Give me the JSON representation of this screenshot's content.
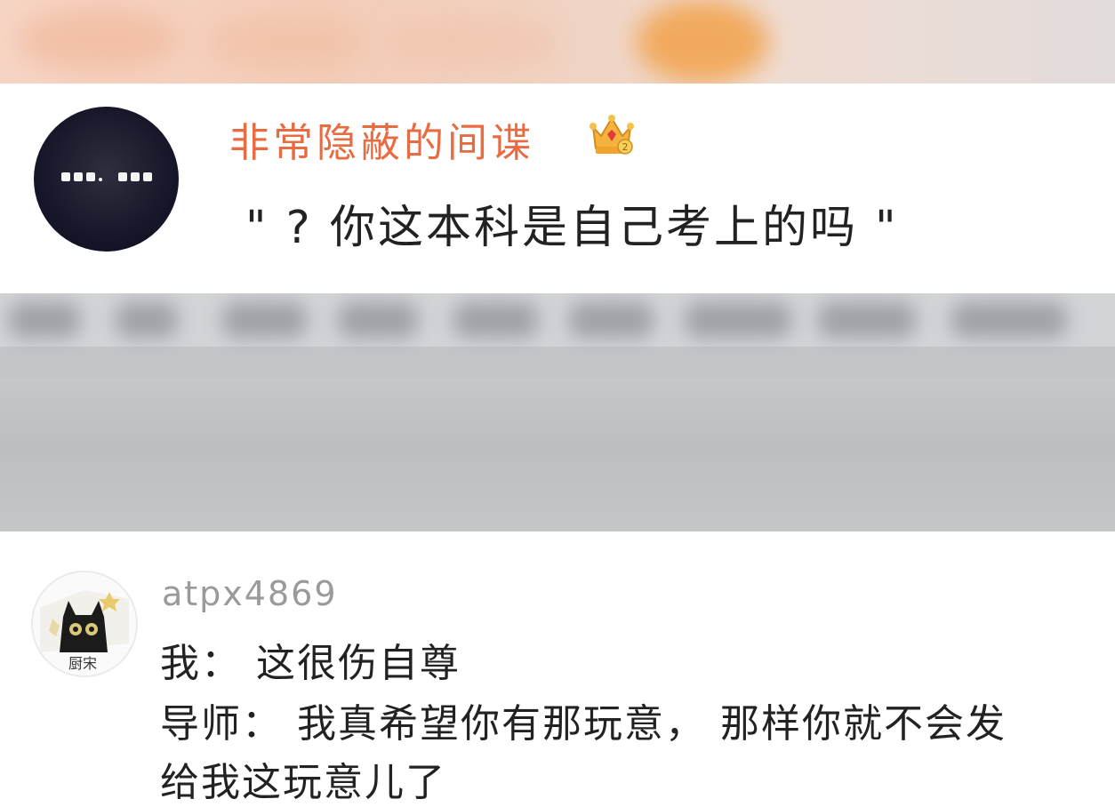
{
  "comments": [
    {
      "username": "非常隐蔽的间谍",
      "badge_icon": "crown-icon",
      "username_color": "#e86c42",
      "text": "\" ?  你这本科是自己考上的吗 \""
    },
    {
      "username": "atpx4869",
      "username_color": "#9a9a9a",
      "avatar_label": "厨宋",
      "lines": [
        "我：  这很伤自尊",
        "导师：  我真希望你有那玩意，  那样你就不会发",
        "给我这玩意儿了"
      ]
    }
  ],
  "colors": {
    "background": "#ffffff",
    "blur_gray": "#c4c5c9",
    "text": "#222222"
  }
}
